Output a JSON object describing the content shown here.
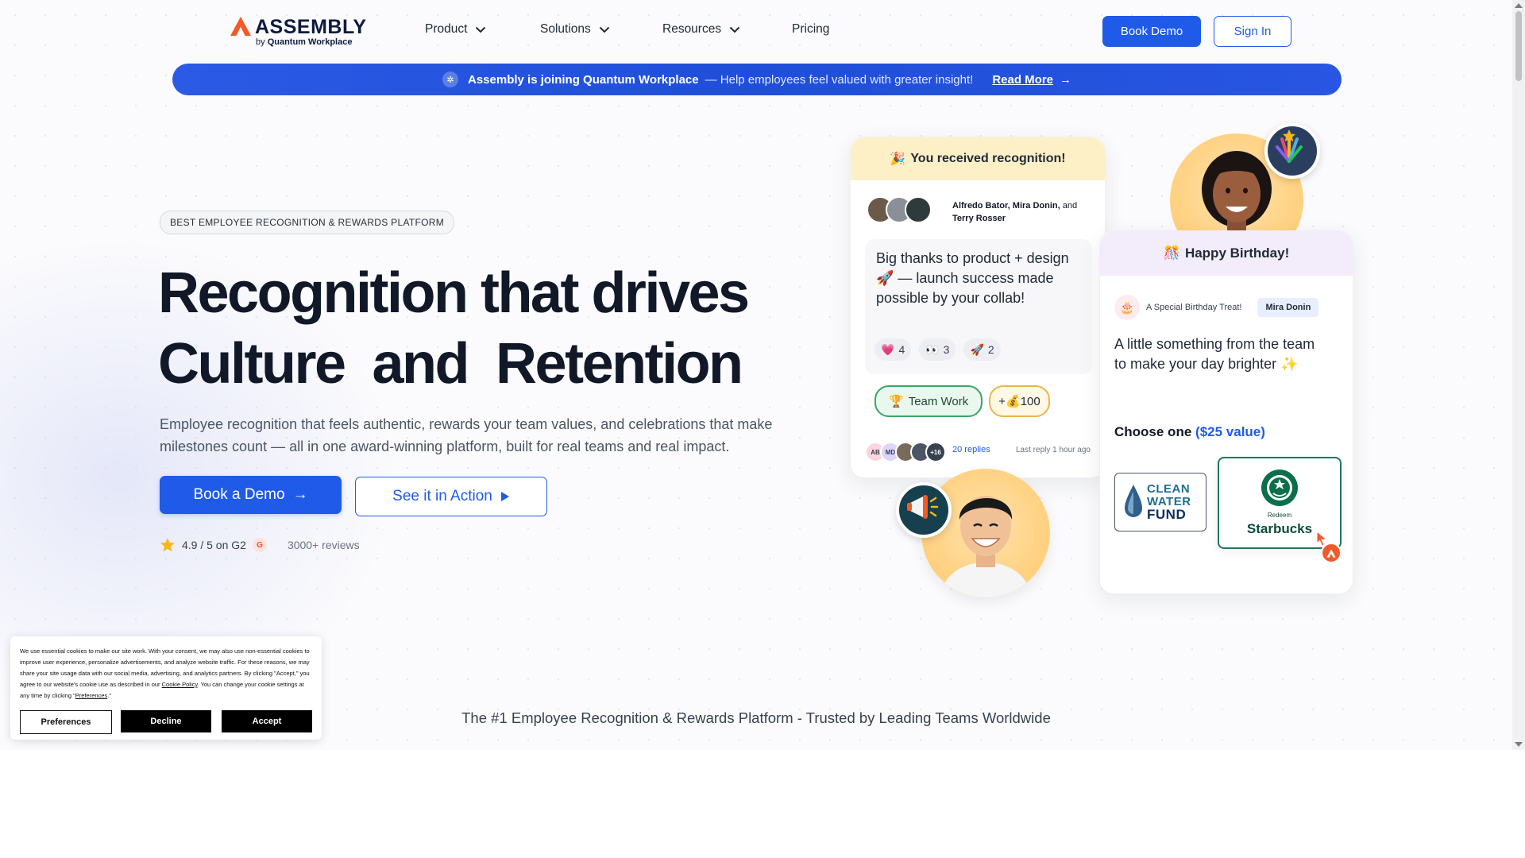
{
  "header": {
    "logo_word": "ASSEMBLY",
    "logo_sub_by": "by",
    "logo_sub_brand": "Quantum Workplace",
    "nav": [
      {
        "label": "Product"
      },
      {
        "label": "Solutions"
      },
      {
        "label": "Resources"
      },
      {
        "label": "Pricing"
      }
    ],
    "book_demo": "Book Demo",
    "sign_in": "Sign In"
  },
  "banner": {
    "strong": "Assembly is joining Quantum Workplace",
    "rest": "— Help employees feel valued with greater insight!",
    "link": "Read More",
    "link_arrow": "→"
  },
  "hero": {
    "badge": "BEST EMPLOYEE RECOGNITION & REWARDS PLATFORM",
    "line1": "Recognition that drives",
    "line2_a": "Culture",
    "line2_b": "and",
    "line2_c": "Retention",
    "subtitle": "Employee recognition that feels authentic, rewards your team values, and celebrations that make milestones count — all in one award-winning platform, built for real teams and real impact.",
    "cta_primary": "Book a Demo",
    "cta_primary_arrow": "→",
    "cta_secondary": "See it in Action",
    "rating": "4.9 / 5 on G2",
    "g2": "G",
    "reviews": "3000+ reviews"
  },
  "recognition_card": {
    "title": "You received recognition!",
    "title_emoji": "🎉",
    "names_strong": "Alfredo Bator, Mira Donin,",
    "names_and": "and",
    "names_last": "Terry Rosser",
    "message": "Big thanks to product + design 🚀 — launch success made possible by your collab!",
    "reactions": [
      {
        "emoji": "💗",
        "count": "4"
      },
      {
        "emoji": "👀",
        "count": "3"
      },
      {
        "emoji": "🚀",
        "count": "2"
      }
    ],
    "tag_value": "Team Work",
    "tag_emoji": "🏆",
    "points": "+💰100",
    "reply_avatars": [
      "AB",
      "MD",
      "",
      "",
      "+16"
    ],
    "replies": "20 replies",
    "last_reply": "Last reply 1 hour ago"
  },
  "birthday_card": {
    "title": "Happy Birthday!",
    "title_emoji": "🎊",
    "treat": "A Special Birthday Treat!",
    "from": "Mira Donin",
    "message": "A little something from the team to make your day brighter ✨",
    "choose": "Choose one",
    "value": "($25 value)",
    "option1_line1": "CLEAN",
    "option1_line2": "WATER",
    "option1_line3": "FUND",
    "option2_redeem": "Redeem",
    "option2_name": "Starbucks"
  },
  "trusted": "The #1 Employee Recognition & Rewards Platform - Trusted by Leading Teams Worldwide",
  "cookie": {
    "text_a": "We use essential cookies to make our site work. With your consent, we may also use non-essential cookies to improve user experience, personalize advertisements, and analyze website traffic. For these reasons, we may share your site usage data with our social media, advertising, and analytics partners. By clicking \"Accept,\" you agree to our website's cookie use as described in our",
    "link_policy": "Cookie Policy",
    "text_b": ". You can change your cookie settings at any time by clicking \"",
    "link_pref": "Preferences",
    "text_c": ".\"",
    "preferences": "Preferences",
    "decline": "Decline",
    "accept": "Accept"
  },
  "colors": {
    "brand_blue": "#1f5be8",
    "logo_orange": "#f15a29",
    "ink": "#111827"
  }
}
